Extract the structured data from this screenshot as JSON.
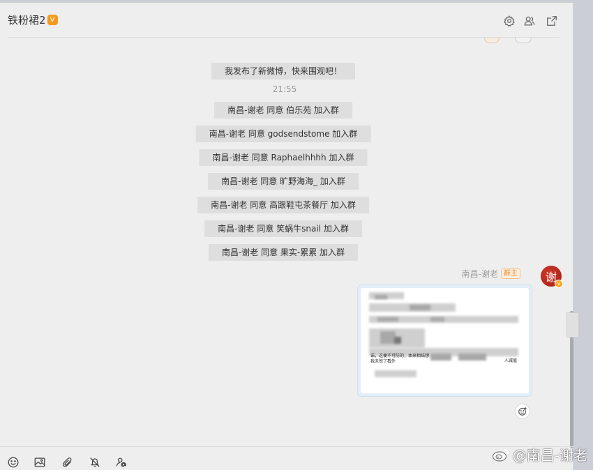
{
  "header": {
    "title": "铁粉裙2",
    "vip_badge": "V",
    "icons": [
      "settings-icon",
      "group-members-icon",
      "popout-icon"
    ]
  },
  "messages": {
    "post_notice": "我发布了新微博，快来围观吧！",
    "time": "21:55",
    "joins": [
      "南昌-谢老 同意 伯乐苑 加入群",
      "南昌-谢老 同意 godsendstome 加入群",
      "南昌-谢老 同意 Raphaelhhhh 加入群",
      "南昌-谢老 同意 旷野海海_ 加入群",
      "南昌-谢老 同意 高跟鞋屯茶餐厅 加入群",
      "南昌-谢老 同意 笑蜗牛snail 加入群",
      "南昌-谢老 同意 果实-累累 加入群"
    ]
  },
  "sender": {
    "name": "南昌-谢老",
    "badge": "群主",
    "avatar_char": "谢",
    "avatar_v": "V"
  },
  "image_message": {
    "fragments": [
      "诺，这便不可防的，本来相结想",
      "我未惊了看外",
      "人减值"
    ]
  },
  "toolbar": {
    "icons": [
      "emoji-icon",
      "image-icon",
      "attachment-icon",
      "mute-notification-icon",
      "mention-icon"
    ]
  },
  "watermark": {
    "text": "@南昌-谢老"
  },
  "colors": {
    "panel_bg": "#eeeeee",
    "system_bubble_bg": "#dedede",
    "vip_orange": "#f39a1e",
    "owner_badge": "#e8902f",
    "avatar_red": "#c0301f"
  }
}
